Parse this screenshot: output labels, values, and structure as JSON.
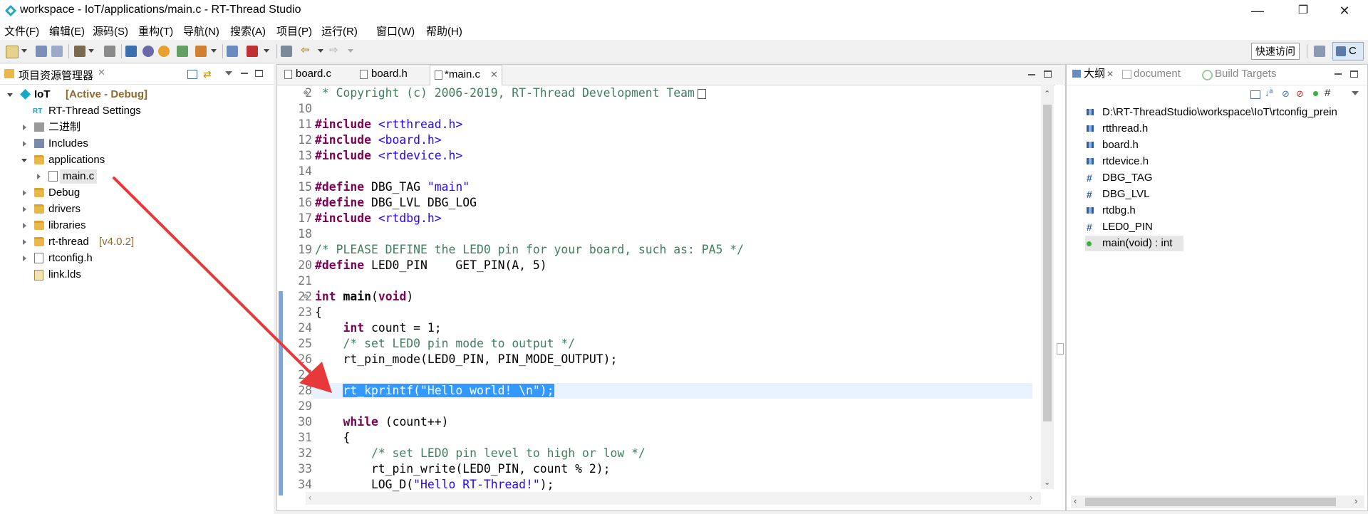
{
  "window": {
    "title": "workspace - IoT/applications/main.c - RT-Thread Studio",
    "minimize": "—",
    "maximize": "❐",
    "close": "✕"
  },
  "menu": [
    {
      "label": "文件(F)"
    },
    {
      "label": "编辑(E)"
    },
    {
      "label": "源码(S)"
    },
    {
      "label": "重构(T)"
    },
    {
      "label": "导航(N)"
    },
    {
      "label": "搜索(A)"
    },
    {
      "label": "项目(P)"
    },
    {
      "label": "运行(R)"
    },
    {
      "label": "窗口(W)"
    },
    {
      "label": "帮助(H)"
    }
  ],
  "toolbar": {
    "quick_access": "快速访问",
    "perspective_label": "C"
  },
  "project_explorer": {
    "title": "项目资源管理器",
    "items": [
      {
        "label": "IoT",
        "extra": "[Active - Debug]"
      },
      {
        "label": "RT-Thread Settings"
      },
      {
        "label": "二进制"
      },
      {
        "label": "Includes"
      },
      {
        "label": "applications"
      },
      {
        "label": "main.c"
      },
      {
        "label": "Debug"
      },
      {
        "label": "drivers"
      },
      {
        "label": "libraries"
      },
      {
        "label": "rt-thread",
        "extra": "[v4.0.2]"
      },
      {
        "label": "rtconfig.h"
      },
      {
        "label": "link.lds"
      }
    ]
  },
  "editor": {
    "tabs": [
      {
        "label": "board.c"
      },
      {
        "label": "board.h"
      },
      {
        "label": "*main.c"
      }
    ],
    "lines": [
      {
        "n": "2",
        "text": " * Copyright (c) 2006-2019, RT-Thread Development Team"
      },
      {
        "n": "10",
        "text": ""
      },
      {
        "n": "11",
        "kw": "#include ",
        "str": "<rtthread.h>"
      },
      {
        "n": "12",
        "kw": "#include ",
        "str": "<board.h>"
      },
      {
        "n": "13",
        "kw": "#include ",
        "str": "<rtdevice.h>"
      },
      {
        "n": "14",
        "text": ""
      },
      {
        "n": "15",
        "kw": "#define ",
        "text": "DBG_TAG ",
        "str": "\"main\""
      },
      {
        "n": "16",
        "kw": "#define ",
        "text": "DBG_LVL DBG_LOG"
      },
      {
        "n": "17",
        "kw": "#include ",
        "str": "<rtdbg.h>"
      },
      {
        "n": "18",
        "text": ""
      },
      {
        "n": "19",
        "cmt": "/* PLEASE DEFINE the LED0 pin for your board, such as: PA5 */"
      },
      {
        "n": "20",
        "kw": "#define ",
        "text": "LED0_PIN    GET_PIN(A, 5)"
      },
      {
        "n": "21",
        "text": ""
      },
      {
        "n": "22",
        "kw": "int ",
        "bold": "main",
        "text2": "(",
        "kw2": "void",
        "text3": ")"
      },
      {
        "n": "23",
        "text": "{"
      },
      {
        "n": "24",
        "indent": "    ",
        "kw": "int ",
        "text": "count = 1;"
      },
      {
        "n": "25",
        "indent": "    ",
        "cmt": "/* set LED0 pin mode to output */"
      },
      {
        "n": "26",
        "text": "    rt_pin_mode(LED0_PIN, PIN_MODE_OUTPUT);"
      },
      {
        "n": "27",
        "text": ""
      },
      {
        "n": "28",
        "indent": "    ",
        "hl": "rt_kprintf(\"Hello world! \\n\");"
      },
      {
        "n": "29",
        "text": ""
      },
      {
        "n": "30",
        "indent": "    ",
        "kw": "while ",
        "text": "(count++)"
      },
      {
        "n": "31",
        "text": "    {"
      },
      {
        "n": "32",
        "indent": "        ",
        "cmt": "/* set LED0 pin level to high or low */"
      },
      {
        "n": "33",
        "text": "        rt_pin_write(LED0_PIN, count % 2);"
      },
      {
        "n": "34",
        "text": "        LOG_D(",
        "str": "\"Hello RT-Thread!\"",
        "text2": ");"
      }
    ]
  },
  "outline": {
    "tabs": [
      {
        "label": "大纲"
      },
      {
        "label": "document"
      },
      {
        "label": "Build Targets"
      }
    ],
    "items": [
      {
        "label": "D:\\RT-ThreadStudio\\workspace\\IoT\\rtconfig_prein",
        "icon": "include-icon"
      },
      {
        "label": "rtthread.h",
        "icon": "include-icon"
      },
      {
        "label": "board.h",
        "icon": "include-icon"
      },
      {
        "label": "rtdevice.h",
        "icon": "include-icon"
      },
      {
        "label": "DBG_TAG",
        "icon": "macro-icon"
      },
      {
        "label": "DBG_LVL",
        "icon": "macro-icon"
      },
      {
        "label": "rtdbg.h",
        "icon": "include-icon"
      },
      {
        "label": "LED0_PIN",
        "icon": "macro-icon"
      },
      {
        "label": "main(void) : int",
        "icon": "function-icon"
      }
    ]
  },
  "colors": {
    "annotation_arrow": "#e8393a",
    "selection": "#3399ff",
    "keyword": "#7f0055",
    "string": "#2a00ff",
    "comment": "#3f7f5f"
  }
}
